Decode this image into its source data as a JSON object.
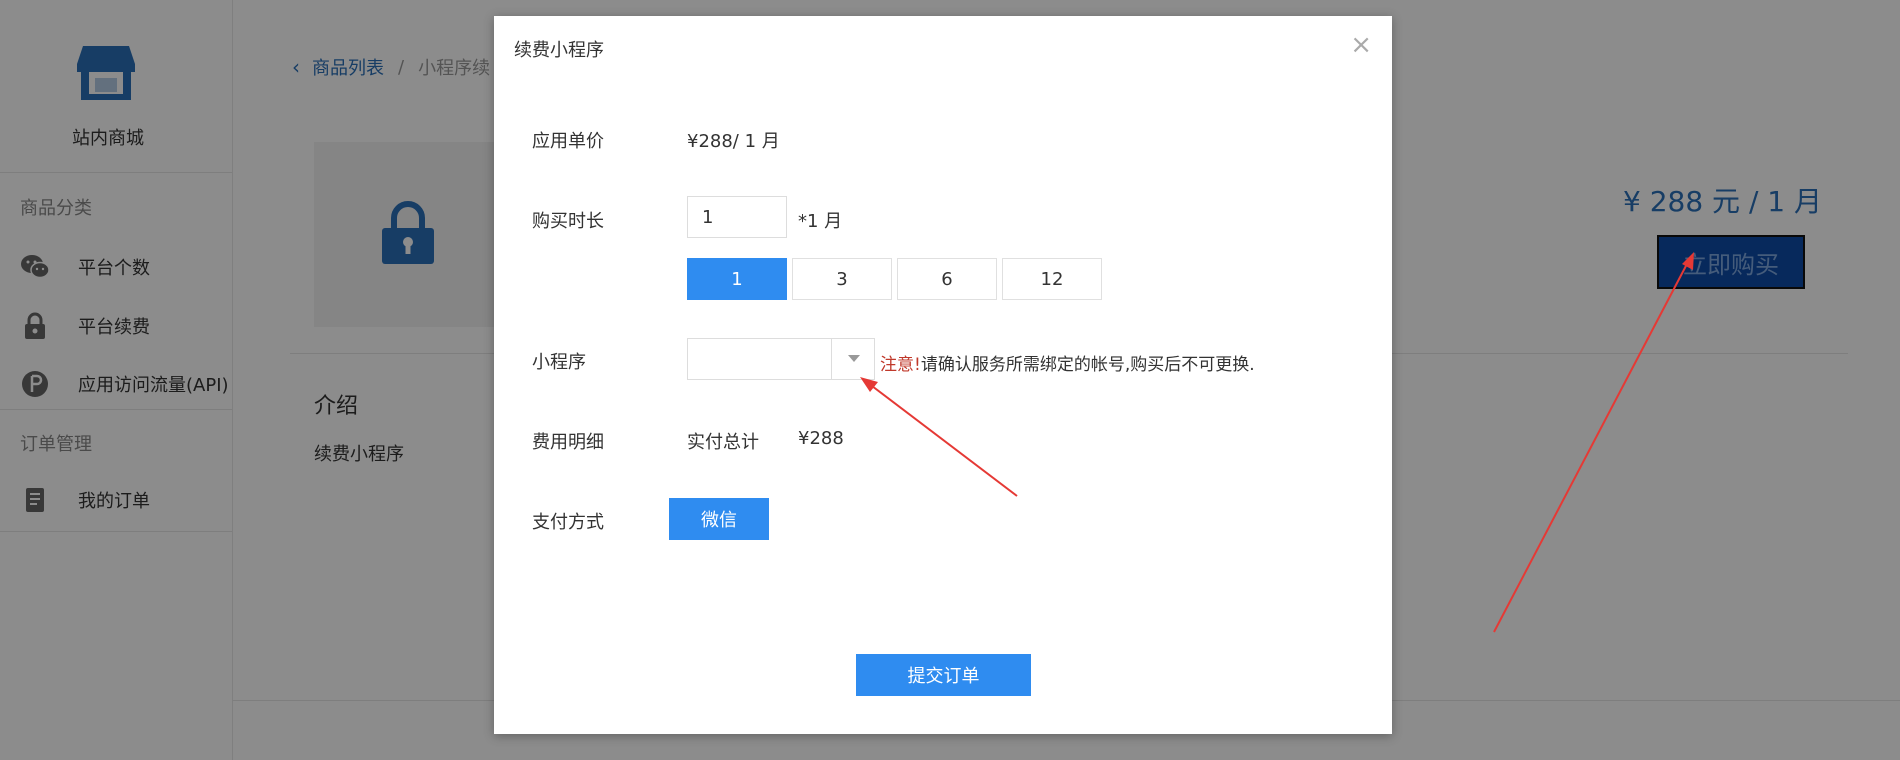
{
  "sidebar": {
    "title": "站内商城",
    "section_category": "商品分类",
    "items": [
      {
        "label": "平台个数",
        "icon": "wechat-icon"
      },
      {
        "label": "平台续费",
        "icon": "lock-icon"
      },
      {
        "label": "应用访问流量(API)",
        "icon": "traffic-icon"
      }
    ],
    "section_orders": "订单管理",
    "order_item": {
      "label": "我的订单",
      "icon": "orders-icon"
    }
  },
  "breadcrumb": {
    "back_icon": "chevron-left-icon",
    "link": "商品列表",
    "separator": "/",
    "current": "小程序续"
  },
  "product": {
    "price": "¥ 288 元 / 1 月",
    "buy_label": "立即购买",
    "intro_heading": "介绍",
    "intro_text": "续费小程序"
  },
  "modal": {
    "title": "续费小程序",
    "close": "×",
    "unit_price_label": "应用单价",
    "unit_price_value": "¥288/ 1 月",
    "duration_label": "购买时长",
    "duration_value": "1",
    "duration_unit": "*1 月",
    "duration_options": [
      "1",
      "3",
      "6",
      "12"
    ],
    "selected_duration": "1",
    "app_label": "小程序",
    "app_select_value": "",
    "notice_warn": "注意!",
    "notice_text": "请确认服务所需绑定的帐号,购买后不可更换.",
    "cost_label": "费用明细",
    "total_label": "实付总计",
    "total_value": "¥288",
    "pay_label": "支付方式",
    "pay_method": "微信",
    "submit_label": "提交订单"
  },
  "colors": {
    "accent": "#2f8cf0",
    "link": "#2a6fb8",
    "buy_button": "#0d4ba8",
    "warning": "#c0392b",
    "annotation_arrow": "#e53935"
  }
}
